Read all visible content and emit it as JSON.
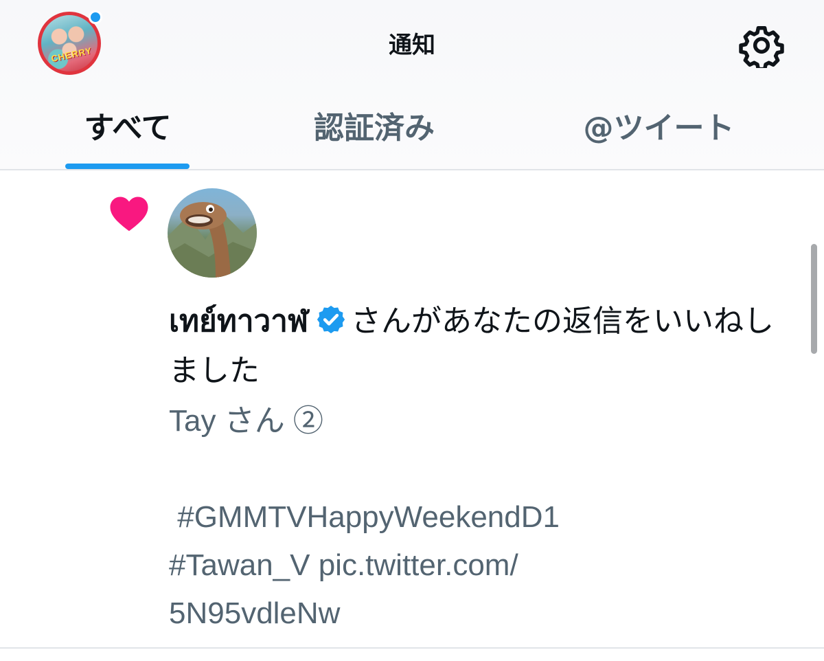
{
  "header": {
    "title": "通知",
    "avatar_text": "CHERRY"
  },
  "tabs": [
    {
      "label": "すべて",
      "active": true
    },
    {
      "label": "認証済み",
      "active": false
    },
    {
      "label": "@ツイート",
      "active": false
    }
  ],
  "notification": {
    "type_icon": "heart-icon",
    "username": "เทย์ทาวาฬ",
    "verified": true,
    "message": "さんがあなたの返信をいいねしました",
    "body": "Tay さん ②\n\n #GMMTVHappyWeekendD1\n#Tawan_V pic.twitter.com/\n5N95vdleNw"
  },
  "colors": {
    "accent": "#1d9bf0",
    "like": "#f91880",
    "text_primary": "#0f1419",
    "text_secondary": "#536471"
  }
}
